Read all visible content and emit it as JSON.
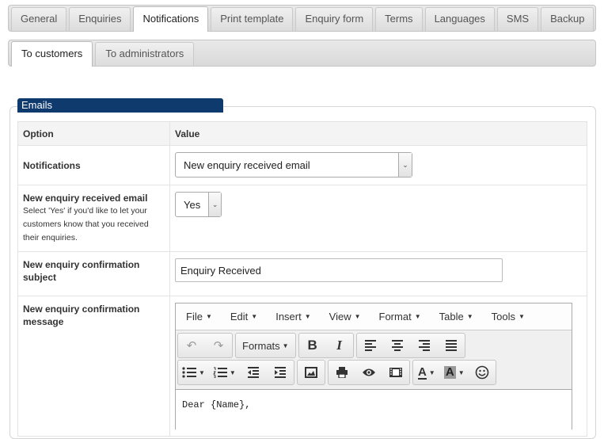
{
  "top_tabs": [
    "General",
    "Enquiries",
    "Notifications",
    "Print template",
    "Enquiry form",
    "Terms",
    "Languages",
    "SMS",
    "Backup"
  ],
  "top_active": "Notifications",
  "sub_tabs": [
    "To customers",
    "To administrators"
  ],
  "sub_active": "To customers",
  "section_title": "Emails",
  "table": {
    "col_option": "Option",
    "col_value": "Value",
    "rows": {
      "notifications": {
        "label": "Notifications",
        "value": "New enquiry received email"
      },
      "received": {
        "label": "New enquiry received email",
        "description": "Select 'Yes' if you'd like to let your customers know that you received their enquiries.",
        "value": "Yes"
      },
      "subject": {
        "label": "New enquiry confirmation subject",
        "value": "Enquiry Received"
      },
      "message": {
        "label": "New enquiry confirmation message"
      }
    }
  },
  "editor": {
    "menus": [
      "File",
      "Edit",
      "Insert",
      "View",
      "Format",
      "Table",
      "Tools"
    ],
    "formats_label": "Formats",
    "bold": "B",
    "italic": "I",
    "forecolor": "A",
    "backcolor": "A",
    "content": "Dear {Name},"
  },
  "colors": {
    "legend_bg": "#0e3a6e"
  },
  "icons": [
    "undo-icon",
    "redo-icon",
    "align-left-icon",
    "align-center-icon",
    "align-right-icon",
    "align-justify-icon",
    "bullet-list-icon",
    "numbered-list-icon",
    "outdent-icon",
    "indent-icon",
    "image-icon",
    "print-icon",
    "preview-icon",
    "media-icon",
    "emoticon-icon"
  ]
}
